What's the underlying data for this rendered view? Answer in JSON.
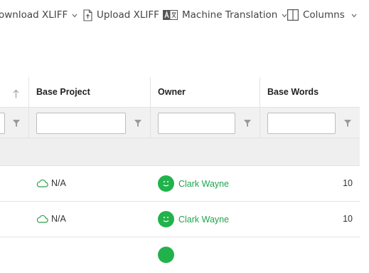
{
  "toolbar": {
    "download_label": "ownload XLIFF",
    "upload_label": "Upload XLIFF",
    "machine_translation_label": "Machine Translation",
    "columns_label": "Columns"
  },
  "columns": {
    "base_project": "Base Project",
    "owner": "Owner",
    "base_words": "Base Words"
  },
  "rows": [
    {
      "base_project": "N/A",
      "owner": "Clark Wayne",
      "base_words": "10"
    },
    {
      "base_project": "N/A",
      "owner": "Clark Wayne",
      "base_words": "10"
    }
  ],
  "colors": {
    "accent": "#22b24c",
    "link": "#23a34f"
  }
}
